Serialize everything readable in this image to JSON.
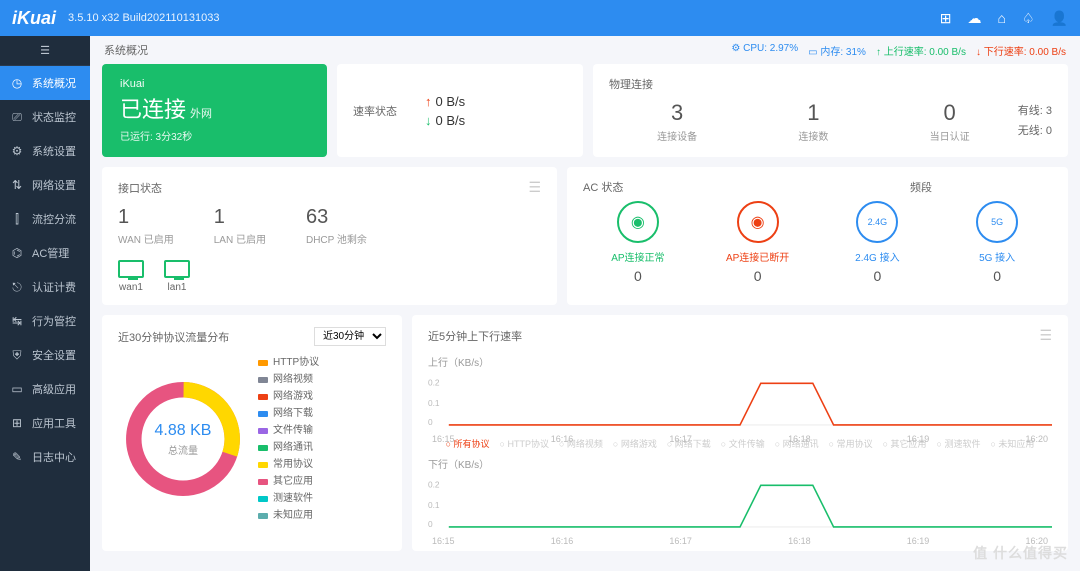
{
  "header": {
    "logo": "iKuai",
    "version": "3.5.10 x32 Build202110131033"
  },
  "topIcons": [
    "apps-icon",
    "cloud-icon",
    "home-icon",
    "bell-icon",
    "user-icon"
  ],
  "crumb": {
    "title": "系统概况",
    "cpu": "CPU: 2.97%",
    "mem": "内存: 31%",
    "up": "上行速率: 0.00 B/s",
    "dn": "下行速率: 0.00 B/s"
  },
  "nav": [
    {
      "icon": "◷",
      "label": "系统概况",
      "active": true
    },
    {
      "icon": "⎚",
      "label": "状态监控"
    },
    {
      "icon": "⚙",
      "label": "系统设置"
    },
    {
      "icon": "⇅",
      "label": "网络设置"
    },
    {
      "icon": "⫿",
      "label": "流控分流"
    },
    {
      "icon": "⌬",
      "label": "AC管理"
    },
    {
      "icon": "⎋",
      "label": "认证计费"
    },
    {
      "icon": "↹",
      "label": "行为管控"
    },
    {
      "icon": "⛨",
      "label": "安全设置"
    },
    {
      "icon": "▭",
      "label": "高级应用"
    },
    {
      "icon": "⊞",
      "label": "应用工具"
    },
    {
      "icon": "✎",
      "label": "日志中心"
    }
  ],
  "connection": {
    "brand": "iKuai",
    "status": "已连接",
    "sub": "外网",
    "uptime": "已运行: 3分32秒"
  },
  "rate": {
    "title": "速率状态",
    "up": "0 B/s",
    "dn": "0 B/s"
  },
  "physical": {
    "title": "物理连接",
    "devices": {
      "num": "3",
      "label": "连接设备"
    },
    "conns": {
      "num": "1",
      "label": "连接数"
    },
    "auth": {
      "num": "0",
      "label": "当日认证"
    },
    "wired": "有线: 3",
    "wireless": "无线: 0"
  },
  "iface": {
    "title": "接口状态",
    "wan": {
      "num": "1",
      "label": "WAN 已启用"
    },
    "lan": {
      "num": "1",
      "label": "LAN 已启用"
    },
    "dhcp": {
      "num": "63",
      "label": "DHCP 池剩余"
    },
    "ports": [
      "wan1",
      "lan1"
    ]
  },
  "ac": {
    "title": "AC 状态",
    "band": "频段",
    "items": [
      {
        "icon": "◉",
        "cls": "g",
        "label": "AP连接正常",
        "count": "0"
      },
      {
        "icon": "◉",
        "cls": "r",
        "label": "AP连接已断开",
        "count": "0"
      },
      {
        "icon": "⌔",
        "cls": "b",
        "label": "2.4G 接入",
        "count": "0",
        "tag": "2.4G"
      },
      {
        "icon": "⌔",
        "cls": "b",
        "label": "5G 接入",
        "count": "0",
        "tag": "5G"
      }
    ]
  },
  "proto": {
    "title": "近30分钟协议流量分布",
    "range": "近30分钟",
    "total": "4.88 KB",
    "totalLabel": "总流量",
    "legend": [
      {
        "c": "#ff9900",
        "t": "HTTP协议"
      },
      {
        "c": "#808695",
        "t": "网络视频"
      },
      {
        "c": "#ed4014",
        "t": "网络游戏"
      },
      {
        "c": "#2d8cf0",
        "t": "网络下载"
      },
      {
        "c": "#9a66e4",
        "t": "文件传输"
      },
      {
        "c": "#19be6b",
        "t": "网络通讯"
      },
      {
        "c": "#ffd700",
        "t": "常用协议"
      },
      {
        "c": "#e75480",
        "t": "其它应用"
      },
      {
        "c": "#00c8c8",
        "t": "测速软件"
      },
      {
        "c": "#5cadad",
        "t": "未知应用"
      }
    ]
  },
  "traffic": {
    "title": "近5分钟上下行速率",
    "upLabel": "上行（KB/s）",
    "dnLabel": "下行（KB/s）",
    "xticks": [
      "16:15",
      "16:16",
      "16:17",
      "16:18",
      "16:19",
      "16:20"
    ],
    "filters": [
      "所有协议",
      "HTTP协议",
      "网络视频",
      "网络游戏",
      "网络下载",
      "文件传输",
      "网络通讯",
      "常用协议",
      "其它应用",
      "测速软件",
      "未知应用"
    ]
  },
  "chart_data": [
    {
      "type": "line",
      "title": "上行（KB/s）",
      "x": [
        "16:15",
        "16:16",
        "16:17",
        "16:18",
        "16:19",
        "16:20"
      ],
      "series": [
        {
          "name": "所有协议",
          "values": [
            0,
            0,
            0,
            0.18,
            0,
            0
          ]
        }
      ],
      "ylim": [
        0,
        0.2
      ],
      "ylabel": "KB/s"
    },
    {
      "type": "line",
      "title": "下行（KB/s）",
      "x": [
        "16:15",
        "16:16",
        "16:17",
        "16:18",
        "16:19",
        "16:20"
      ],
      "series": [
        {
          "name": "所有协议",
          "values": [
            0,
            0,
            0,
            0.18,
            0,
            0
          ]
        }
      ],
      "ylim": [
        0,
        0.2
      ],
      "ylabel": "KB/s"
    },
    {
      "type": "pie",
      "title": "近30分钟协议流量分布",
      "categories": [
        "HTTP协议",
        "网络视频",
        "网络游戏",
        "网络下载",
        "文件传输",
        "网络通讯",
        "常用协议",
        "其它应用",
        "测速软件",
        "未知应用"
      ],
      "values": [
        0,
        0,
        0,
        0,
        0,
        0,
        30,
        70,
        0,
        0
      ],
      "total": "4.88 KB"
    }
  ],
  "watermark": "值 什么值得买"
}
